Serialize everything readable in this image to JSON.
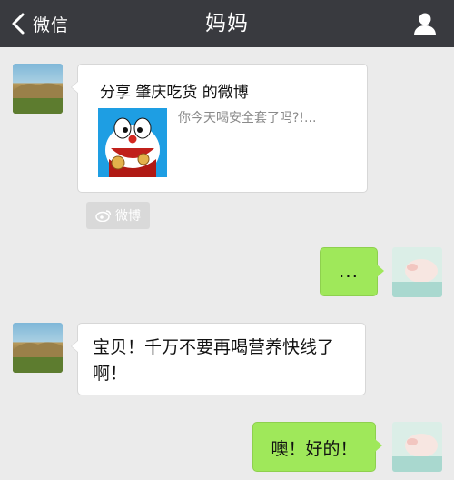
{
  "nav": {
    "back_label": "微信",
    "title": "妈妈"
  },
  "messages": {
    "share": {
      "title": "分享 肇庆吃货 的微博",
      "description": "你今天喝安全套了吗?!..."
    },
    "source_tag": "微博",
    "sent_1": "...",
    "received_2": "宝贝！千万不要再喝营养快线了啊！",
    "reply": "噢！好的！"
  },
  "colors": {
    "nav_bg": "#393a3f",
    "chat_bg": "#ebebeb",
    "sent_bubble": "#9fe85a",
    "received_bubble": "#ffffff"
  },
  "icons": {
    "back": "chevron-left-icon",
    "profile": "person-icon",
    "weibo": "weibo-icon"
  }
}
